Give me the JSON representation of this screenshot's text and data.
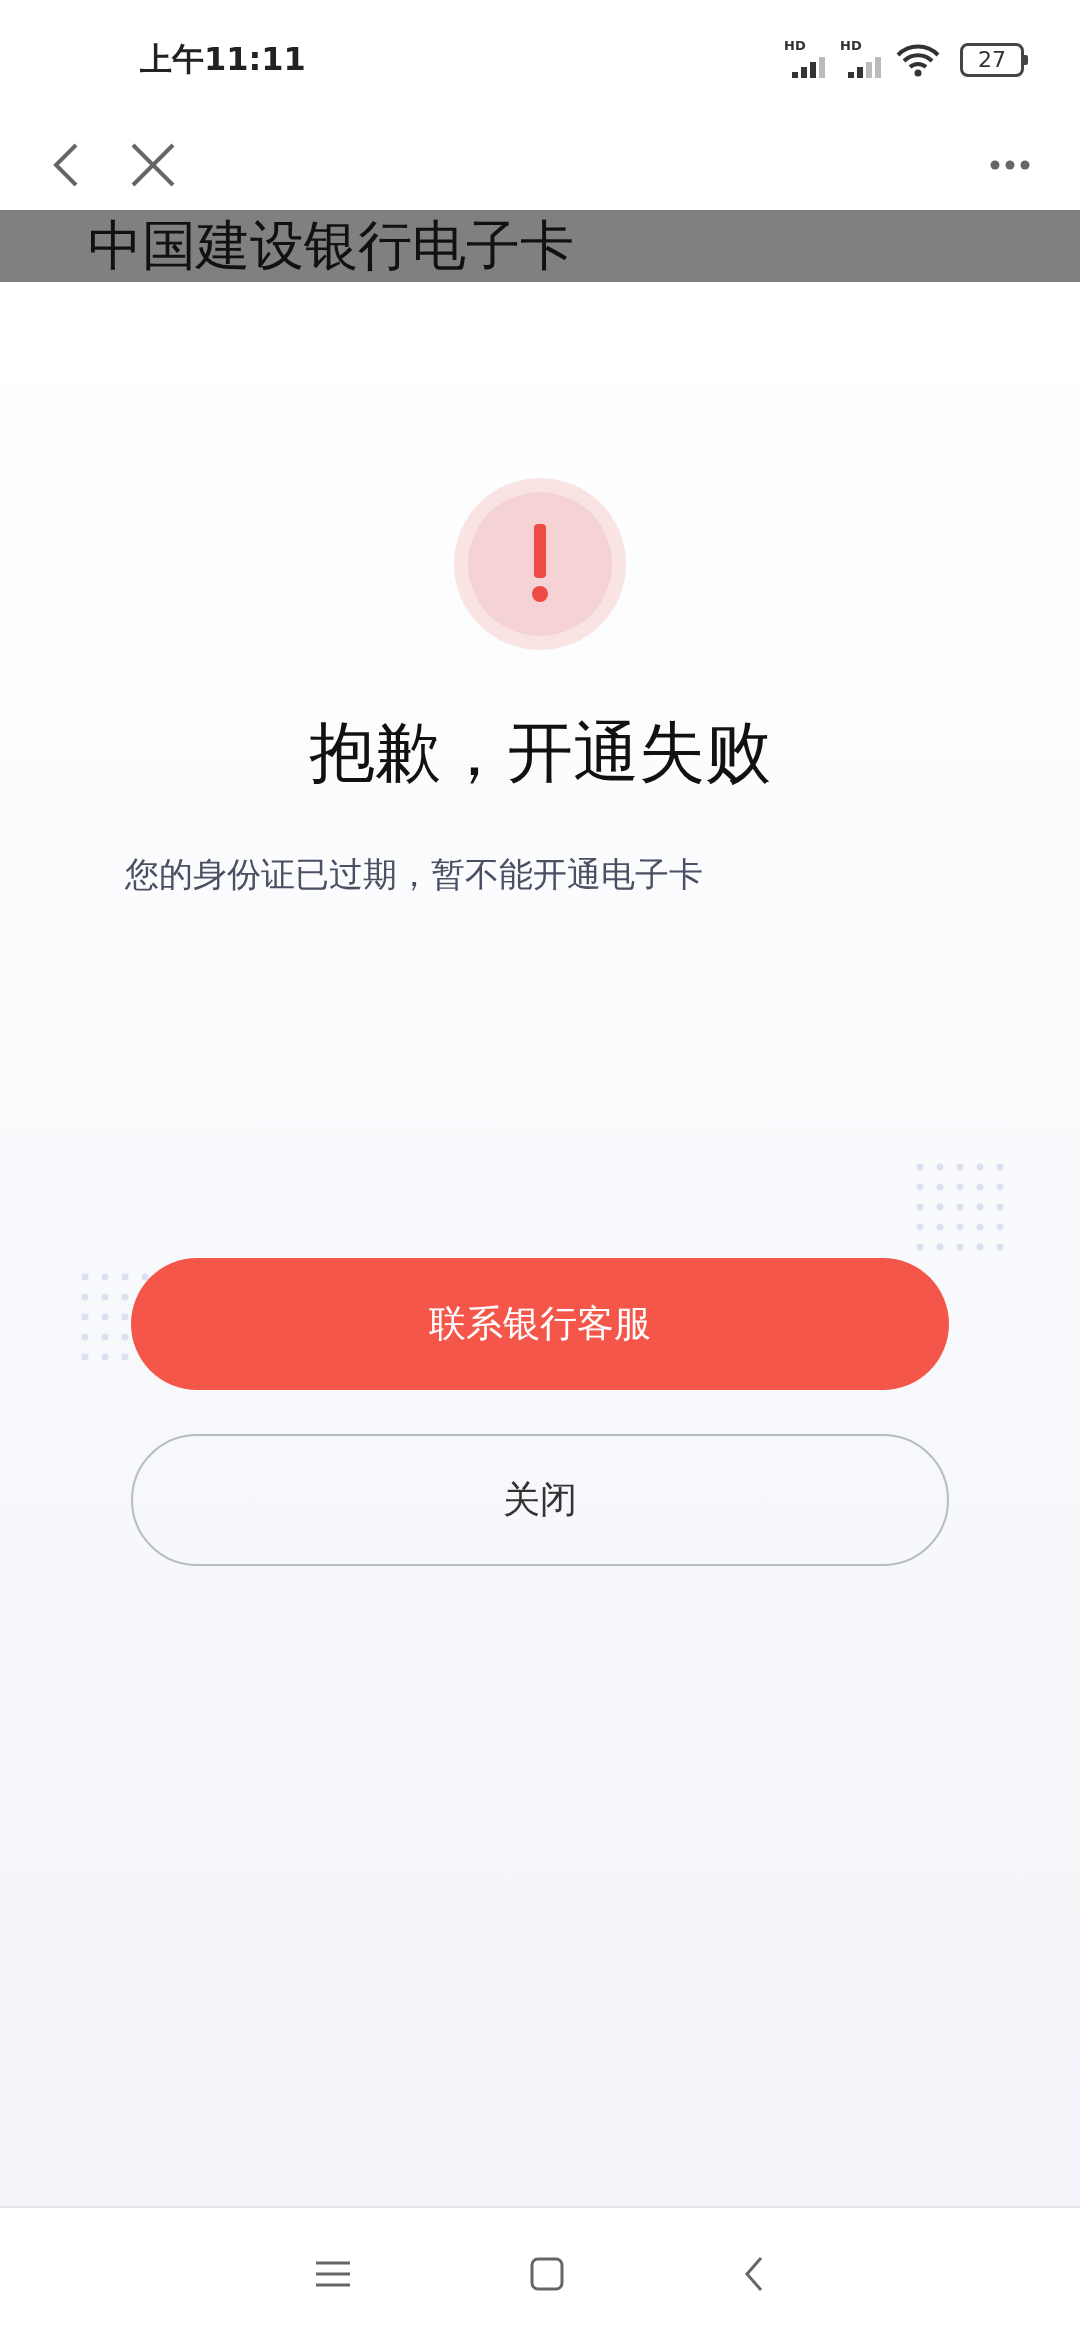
{
  "status_bar": {
    "time": "上午11:11",
    "signals": [
      {
        "label": "HD"
      },
      {
        "label": "HD"
      }
    ],
    "battery": "27"
  },
  "page_title": "中国建设银行电子卡",
  "dialog": {
    "title": "抱歉，开通失败",
    "message": "您的身份证已过期，暂不能开通电子卡",
    "buttons": [
      {
        "label": "联系银行客服",
        "kind": "primary"
      },
      {
        "label": "关闭",
        "kind": "secondary"
      }
    ]
  }
}
